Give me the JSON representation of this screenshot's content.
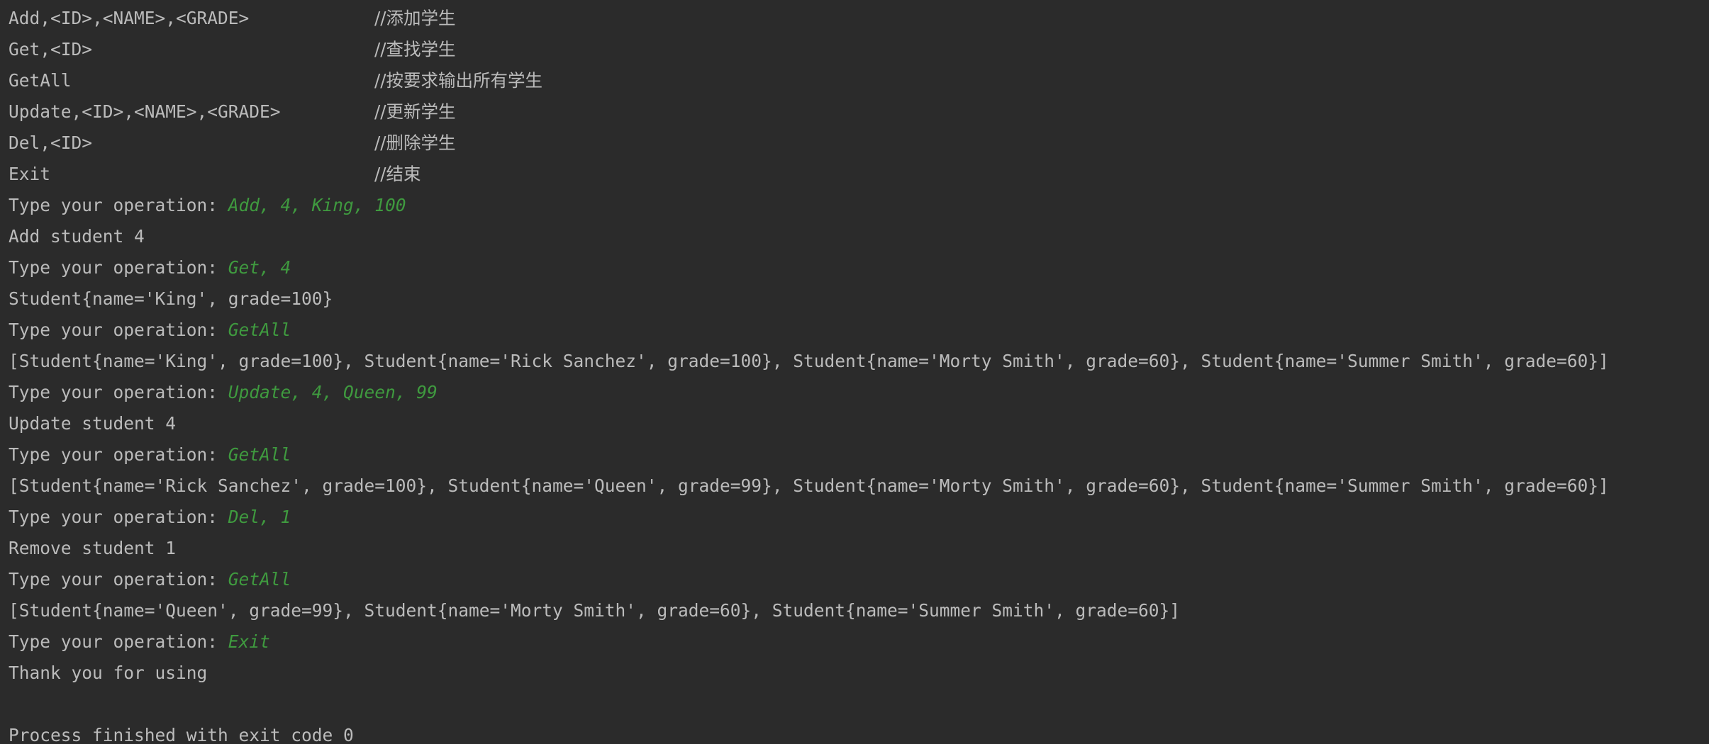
{
  "help": [
    {
      "command": "Add,<ID>,<NAME>,<GRADE>",
      "comment": "//添加学生"
    },
    {
      "command": "Get,<ID>",
      "comment": "//查找学生"
    },
    {
      "command": "GetAll",
      "comment": "//按要求输出所有学生"
    },
    {
      "command": "Update,<ID>,<NAME>,<GRADE>",
      "comment": "//更新学生"
    },
    {
      "command": "Del,<ID>",
      "comment": "//删除学生"
    },
    {
      "command": "Exit",
      "comment": "//结束"
    }
  ],
  "prompt": "Type your operation: ",
  "session": [
    {
      "input": "Add, 4, King, 100",
      "output": "Add student 4"
    },
    {
      "input": "Get, 4",
      "output": "Student{name='King', grade=100}"
    },
    {
      "input": "GetAll",
      "output": "[Student{name='King', grade=100}, Student{name='Rick Sanchez', grade=100}, Student{name='Morty Smith', grade=60}, Student{name='Summer Smith', grade=60}]"
    },
    {
      "input": "Update, 4, Queen, 99",
      "output": "Update student 4"
    },
    {
      "input": "GetAll",
      "output": "[Student{name='Rick Sanchez', grade=100}, Student{name='Queen', grade=99}, Student{name='Morty Smith', grade=60}, Student{name='Summer Smith', grade=60}]"
    },
    {
      "input": "Del, 1",
      "output": "Remove student 1"
    },
    {
      "input": "GetAll",
      "output": "[Student{name='Queen', grade=99}, Student{name='Morty Smith', grade=60}, Student{name='Summer Smith', grade=60}]"
    },
    {
      "input": "Exit",
      "output": "Thank you for using"
    }
  ],
  "exit_message": "Process finished with exit code 0",
  "colors": {
    "background": "#2b2b2b",
    "text": "#bbbbbb",
    "user_input": "#3f9a3f"
  }
}
